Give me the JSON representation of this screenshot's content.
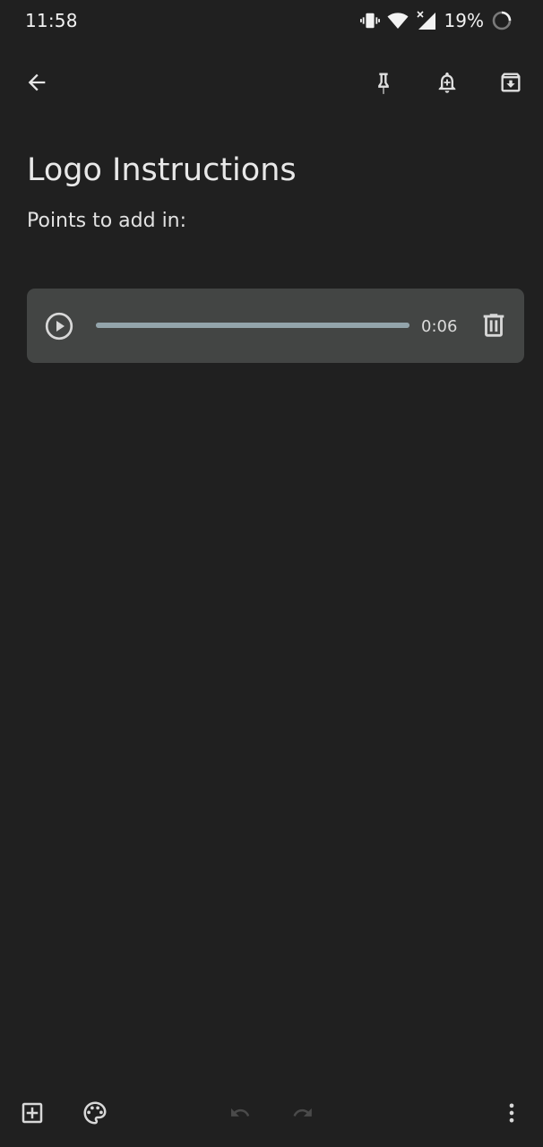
{
  "status_bar": {
    "time": "11:58",
    "battery_percent": "19%",
    "icons": [
      "vibrate-icon",
      "wifi-icon",
      "signal-icon",
      "battery-saver-icon"
    ]
  },
  "toolbar": {
    "icons": [
      "back-arrow-icon",
      "pin-icon",
      "reminder-bell-icon",
      "archive-icon"
    ]
  },
  "note": {
    "title": "Logo Instructions",
    "body": "Points to add in:"
  },
  "audio": {
    "duration": "0:06",
    "progress": 1.0,
    "icons": [
      "play-icon",
      "delete-icon"
    ]
  },
  "bottom_bar": {
    "icons": [
      "add-box-icon",
      "palette-icon",
      "undo-icon",
      "redo-icon",
      "more-vert-icon"
    ]
  },
  "colors": {
    "background": "#202020",
    "card": "#434544",
    "track": "#7c8a90",
    "icon": "#d8d8d8",
    "icon_disabled": "#4a4a4a"
  }
}
